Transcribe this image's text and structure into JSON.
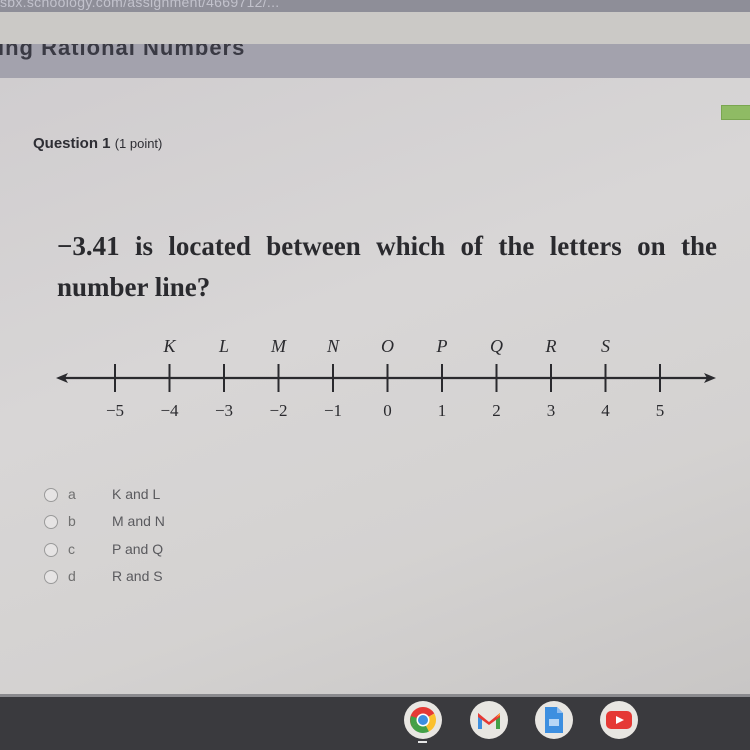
{
  "browser": {
    "url_fragment": "sbx.schoology.com/assignment/4669712/..."
  },
  "course": {
    "title_fragment": "ing Rational Numbers"
  },
  "question": {
    "title": "Question 1",
    "points": "(1 point)",
    "prompt": "−3.41 is located between which of the letters on the number line?"
  },
  "number_line": {
    "letters": [
      "K",
      "L",
      "M",
      "N",
      "O",
      "P",
      "Q",
      "R",
      "S"
    ],
    "letter_positions": [
      -4,
      -3,
      -2,
      -1,
      0,
      1,
      2,
      3,
      4
    ],
    "ticks": [
      "−5",
      "−4",
      "−3",
      "−2",
      "−1",
      "0",
      "1",
      "2",
      "3",
      "4",
      "5"
    ],
    "range": [
      -5,
      5
    ]
  },
  "options": [
    {
      "letter": "a",
      "text": "K and L"
    },
    {
      "letter": "b",
      "text": "M and N"
    },
    {
      "letter": "c",
      "text": "P and Q"
    },
    {
      "letter": "d",
      "text": "R and S"
    }
  ],
  "taskbar": {
    "apps": [
      "chrome-icon",
      "gmail-icon",
      "docs-icon",
      "youtube-icon"
    ]
  },
  "colors": {
    "progress_accent": "#8fbb64",
    "youtube_red": "#e53935",
    "docs_blue": "#3d8fe0"
  }
}
